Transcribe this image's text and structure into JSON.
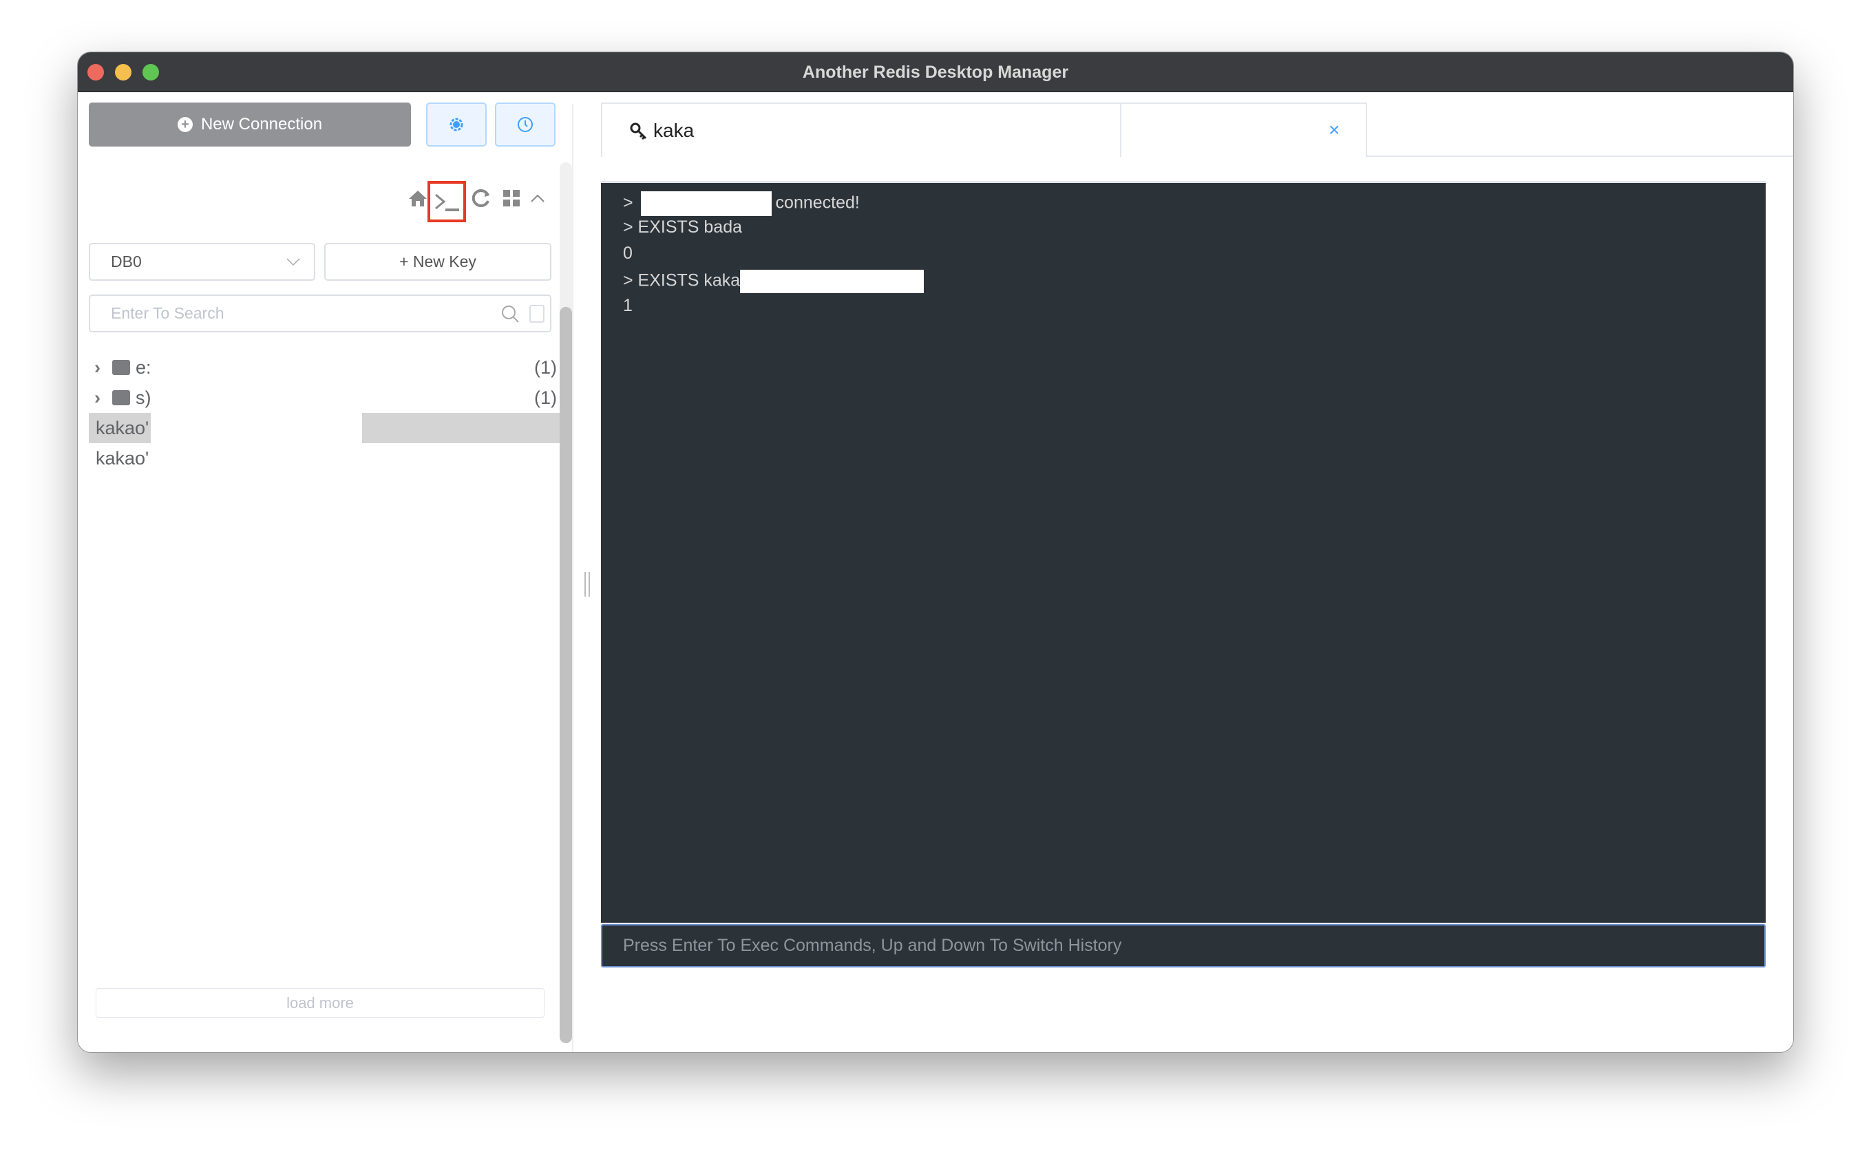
{
  "window": {
    "title": "Another Redis Desktop Manager"
  },
  "sidebar": {
    "new_connection_label": "New Connection",
    "settings_icon": "gear-icon",
    "history_icon": "clock-icon",
    "toolbar": [
      "home-icon",
      "terminal-icon",
      "refresh-icon",
      "grid-icon",
      "chevron-up-icon"
    ],
    "db_select": "DB0",
    "new_key_label": "+ New Key",
    "search_placeholder": "Enter To Search",
    "tree": [
      {
        "type": "folder",
        "label": "e:",
        "count": "(1)"
      },
      {
        "type": "folder",
        "label": "s)",
        "count": "(1)"
      },
      {
        "type": "key",
        "label": "kakao'",
        "selected": true
      },
      {
        "type": "key",
        "label": "kakao'"
      }
    ],
    "load_more": "load more"
  },
  "tab": {
    "label": "kaka",
    "close": "×"
  },
  "console": {
    "lines": [
      "> ",
      "connected!",
      "> EXISTS bada",
      "0",
      "> EXISTS kaka",
      "1"
    ],
    "input_placeholder": "Press Enter To Exec Commands, Up and Down To Switch History"
  },
  "colors": {
    "accent": "#409eff",
    "console_bg": "#2b3238",
    "highlight": "#e53a24"
  }
}
